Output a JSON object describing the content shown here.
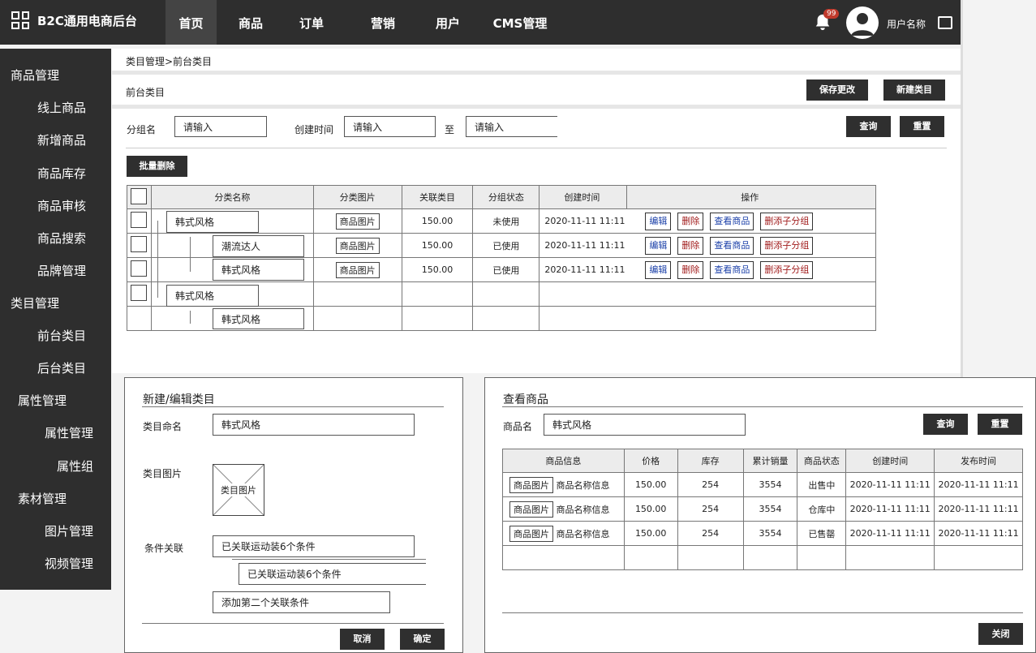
{
  "header": {
    "app_title": "B2C通用电商后台",
    "nav": [
      "首页",
      "商品",
      "订单",
      "营销",
      "用户",
      "CMS管理"
    ],
    "badge": "99",
    "username": "用户名称"
  },
  "sidebar": [
    "商品管理",
    "线上商品",
    "新增商品",
    "商品库存",
    "商品审核",
    "商品搜索",
    "品牌管理",
    "类目管理",
    "前台类目",
    "后台类目",
    "属性管理",
    "属性管理",
    "属性组",
    "素材管理",
    "图片管理",
    "视频管理"
  ],
  "breadcrumb": "类目管理>前台类目",
  "section_title": "前台类目",
  "toolbar": {
    "save": "保存更改",
    "new": "新建类目"
  },
  "filter": {
    "group_label": "分组名",
    "group_placeholder": "请输入",
    "time_label": "创建时间",
    "time_from_placeholder": "请输入",
    "to_label": "至",
    "time_to_placeholder": "请输入",
    "query": "查询",
    "reset": "重置"
  },
  "batch_delete": "批量删除",
  "table": {
    "headers": [
      "分类名称",
      "分类图片",
      "关联类目",
      "分组状态",
      "创建时间",
      "操作"
    ],
    "rows": [
      {
        "name": "韩式风格",
        "img": "商品图片",
        "count": "150.00",
        "status": "未使用",
        "time": "2020-11-11 11:11"
      },
      {
        "name": "潮流达人",
        "img": "商品图片",
        "count": "150.00",
        "status": "已使用",
        "time": "2020-11-11 11:11"
      },
      {
        "name": "韩式风格",
        "img": "商品图片",
        "count": "150.00",
        "status": "已使用",
        "time": "2020-11-11 11:11"
      }
    ],
    "extra_names": [
      "韩式风格",
      "韩式风格"
    ],
    "actions": {
      "edit": "编辑",
      "delete": "删除",
      "view": "查看商品",
      "sub": "删添子分组"
    }
  },
  "edit_panel": {
    "title": "新建/编辑类目",
    "name_label": "类目命名",
    "name_value": "韩式风格",
    "img_label": "类目图片",
    "img_text": "类目图片",
    "cond_label": "条件关联",
    "cond1": "已关联运动装6个条件",
    "cond2": "已关联运动装6个条件",
    "cond_add": "添加第二个关联条件",
    "cancel": "取消",
    "ok": "确定"
  },
  "view_panel": {
    "title": "查看商品",
    "name_label": "商品名",
    "name_value": "韩式风格",
    "query": "查询",
    "reset": "重置",
    "headers": [
      "商品信息",
      "价格",
      "库存",
      "累计销量",
      "商品状态",
      "创建时间",
      "发布时间"
    ],
    "rows": [
      {
        "img": "商品图片",
        "info": "商品名称信息",
        "price": "150.00",
        "stock": "254",
        "sales": "3554",
        "status": "出售中",
        "ctime": "2020-11-11 11:11",
        "ptime": "2020-11-11 11:11"
      },
      {
        "img": "商品图片",
        "info": "商品名称信息",
        "price": "150.00",
        "stock": "254",
        "sales": "3554",
        "status": "仓库中",
        "ctime": "2020-11-11 11:11",
        "ptime": "2020-11-11 11:11"
      },
      {
        "img": "商品图片",
        "info": "商品名称信息",
        "price": "150.00",
        "stock": "254",
        "sales": "3554",
        "status": "已售罄",
        "ctime": "2020-11-11 11:11",
        "ptime": "2020-11-11 11:11"
      }
    ],
    "close": "关闭"
  }
}
